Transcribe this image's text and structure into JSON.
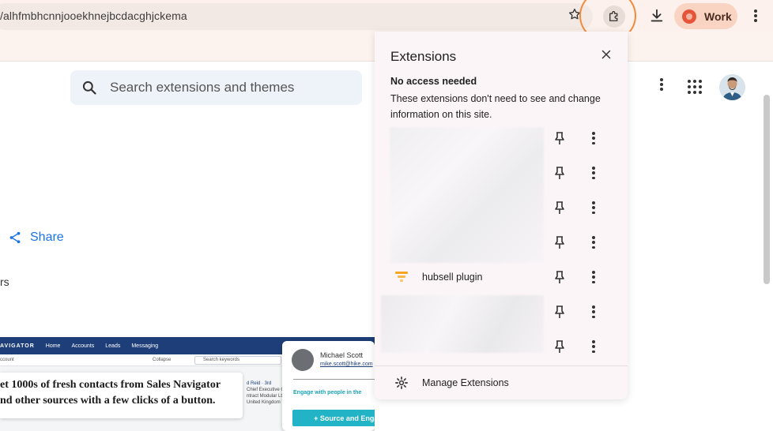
{
  "browser": {
    "url": "/alhfmbhcnnjooekhnejbcdacghjckema",
    "profile_label": "Work"
  },
  "page": {
    "search_placeholder": "Search extensions and themes",
    "share_label": "Share",
    "partial_text": "rs"
  },
  "preview": {
    "nav_items": [
      "AVIGATOR",
      "Home",
      "Accounts",
      "Leads",
      "Messaging"
    ],
    "row_left": "ccount",
    "row_collapse": "Collapse",
    "row_search": "Search keywords",
    "caption_line1": "et 1000s of fresh contacts from Sales Navigator",
    "caption_line2": "nd other sources with a few clicks of a button.",
    "profile_name": "Michael Scott",
    "profile_email": "mike.scott@hike.com",
    "engage_text": "Engage with people in the",
    "source_button": "+ Source and Engage",
    "lead_line1": "d Reid · 3rd",
    "lead_line2": "Chief Executive Of",
    "lead_line3": "ntract Modular Ltd",
    "lead_line4": "United Kingdom"
  },
  "extensions_popup": {
    "title": "Extensions",
    "section_title": "No access needed",
    "section_desc": "These extensions don't need to see and change information on this site.",
    "hubsell_label": "hubsell plugin",
    "manage_label": "Manage Extensions"
  },
  "colors": {
    "highlight_ring": "#ef8b3d",
    "accent_blue": "#1a73e8",
    "profile_chip": "#f9d4c2"
  }
}
